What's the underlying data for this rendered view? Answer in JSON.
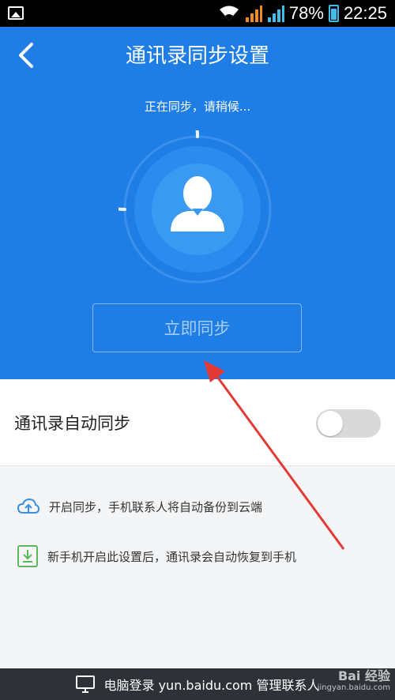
{
  "status_bar": {
    "battery": "78%",
    "time": "22:25"
  },
  "header": {
    "title": "通讯录同步设置"
  },
  "sync": {
    "status_text": "正在同步，请稍候...",
    "button_label": "立即同步"
  },
  "settings": {
    "auto_sync_label": "通讯录自动同步",
    "auto_sync_enabled": false
  },
  "info": [
    {
      "text": "开启同步，手机联系人将自动备份到云端",
      "icon": "cloud-upload-icon"
    },
    {
      "text": "新手机开启此设置后，通讯录会自动恢复到手机",
      "icon": "download-icon"
    }
  ],
  "footer": {
    "text": "电脑登录 yun.baidu.com 管理联系人"
  },
  "watermark": {
    "brand": "Bai 经验",
    "url": "jingyan.baidu.com"
  },
  "colors": {
    "primary": "#1e7ee6",
    "arrow": "#e53935",
    "footer": "#2e3238"
  }
}
